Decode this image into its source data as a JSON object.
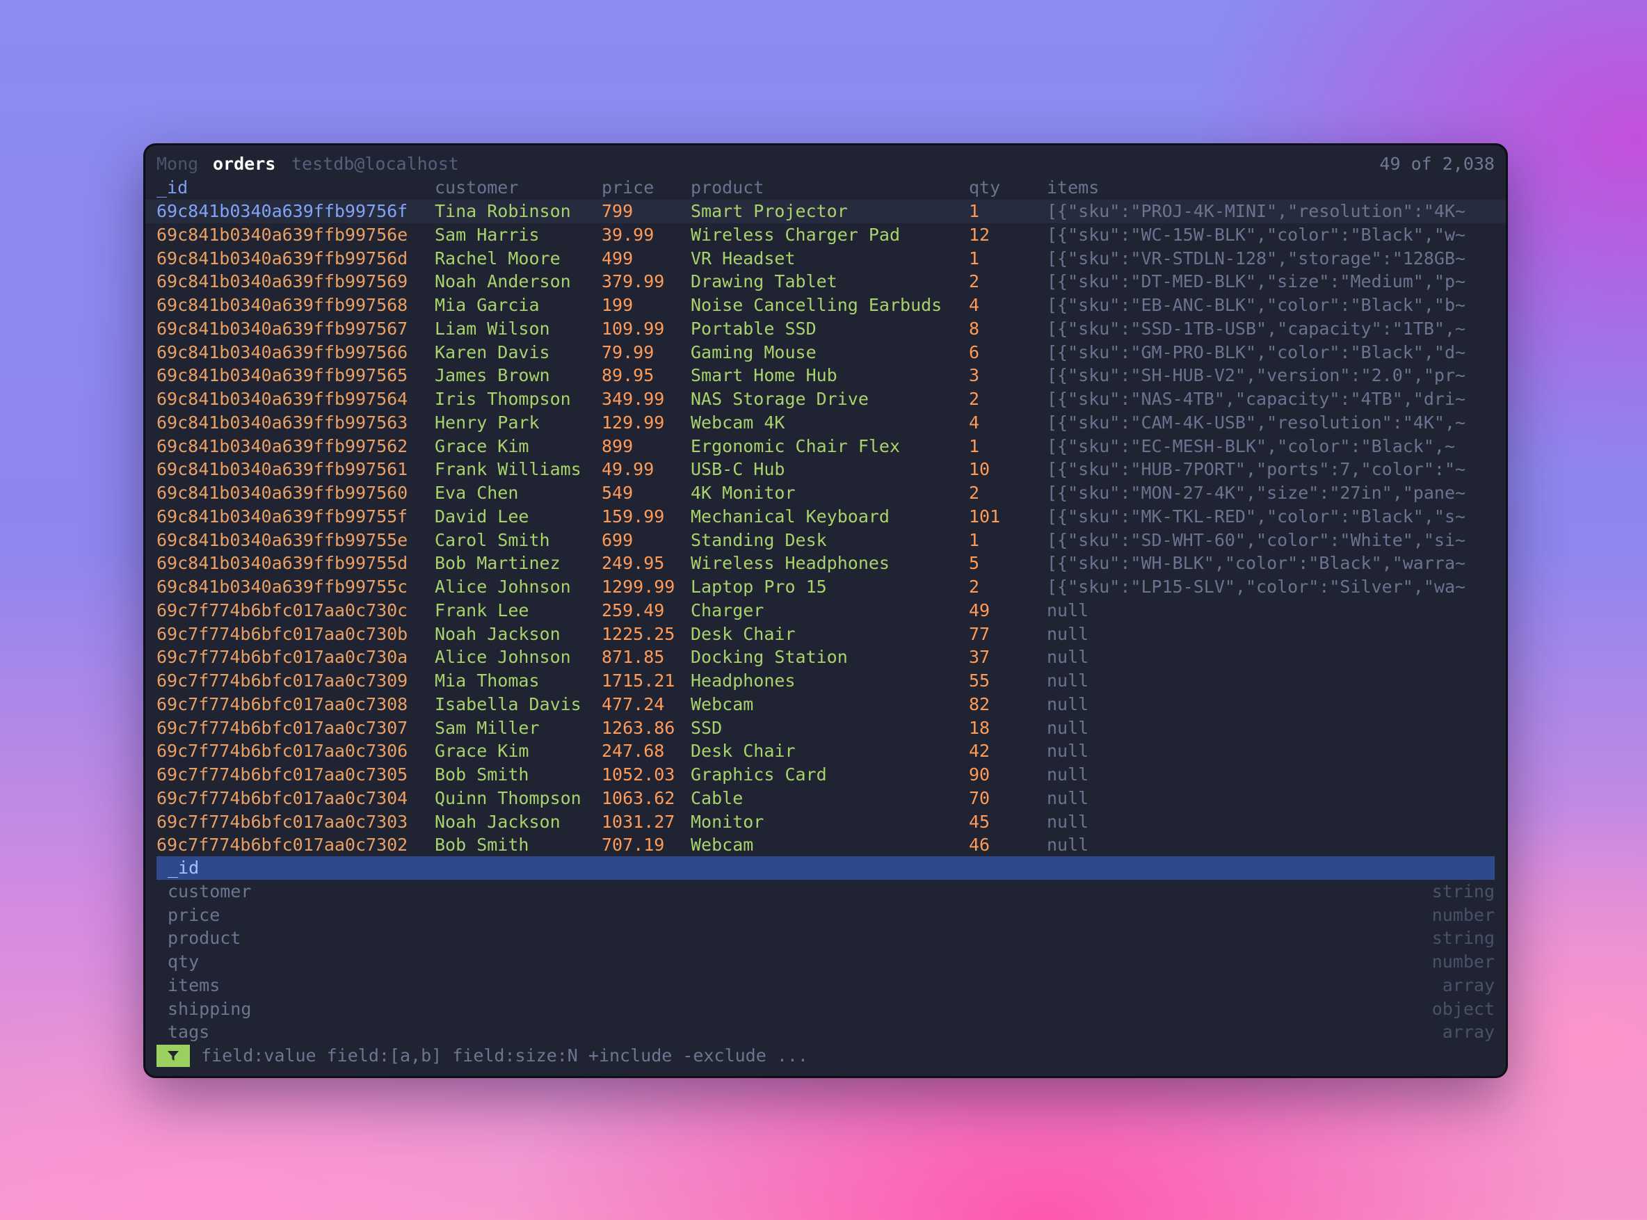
{
  "titlebar": {
    "app": "Mong",
    "collection": "orders",
    "database": "testdb@localhost",
    "count": "49 of 2,038"
  },
  "columns": [
    "_id",
    "customer",
    "price",
    "product",
    "qty",
    "items"
  ],
  "rows": [
    {
      "id": "69c841b0340a639ffb99756f",
      "customer": "Tina Robinson",
      "price": "799",
      "product": "Smart Projector",
      "qty": "1",
      "items": "[{\"sku\":\"PROJ-4K-MINI\",\"resolution\":\"4K~"
    },
    {
      "id": "69c841b0340a639ffb99756e",
      "customer": "Sam Harris",
      "price": "39.99",
      "product": "Wireless Charger Pad",
      "qty": "12",
      "items": "[{\"sku\":\"WC-15W-BLK\",\"color\":\"Black\",\"w~"
    },
    {
      "id": "69c841b0340a639ffb99756d",
      "customer": "Rachel Moore",
      "price": "499",
      "product": "VR Headset",
      "qty": "1",
      "items": "[{\"sku\":\"VR-STDLN-128\",\"storage\":\"128GB~"
    },
    {
      "id": "69c841b0340a639ffb997569",
      "customer": "Noah Anderson",
      "price": "379.99",
      "product": "Drawing Tablet",
      "qty": "2",
      "items": "[{\"sku\":\"DT-MED-BLK\",\"size\":\"Medium\",\"p~"
    },
    {
      "id": "69c841b0340a639ffb997568",
      "customer": "Mia Garcia",
      "price": "199",
      "product": "Noise Cancelling Earbuds",
      "qty": "4",
      "items": "[{\"sku\":\"EB-ANC-BLK\",\"color\":\"Black\",\"b~"
    },
    {
      "id": "69c841b0340a639ffb997567",
      "customer": "Liam Wilson",
      "price": "109.99",
      "product": "Portable SSD",
      "qty": "8",
      "items": "[{\"sku\":\"SSD-1TB-USB\",\"capacity\":\"1TB\",~"
    },
    {
      "id": "69c841b0340a639ffb997566",
      "customer": "Karen Davis",
      "price": "79.99",
      "product": "Gaming Mouse",
      "qty": "6",
      "items": "[{\"sku\":\"GM-PRO-BLK\",\"color\":\"Black\",\"d~"
    },
    {
      "id": "69c841b0340a639ffb997565",
      "customer": "James Brown",
      "price": "89.95",
      "product": "Smart Home Hub",
      "qty": "3",
      "items": "[{\"sku\":\"SH-HUB-V2\",\"version\":\"2.0\",\"pr~"
    },
    {
      "id": "69c841b0340a639ffb997564",
      "customer": "Iris Thompson",
      "price": "349.99",
      "product": "NAS Storage Drive",
      "qty": "2",
      "items": "[{\"sku\":\"NAS-4TB\",\"capacity\":\"4TB\",\"dri~"
    },
    {
      "id": "69c841b0340a639ffb997563",
      "customer": "Henry Park",
      "price": "129.99",
      "product": "Webcam 4K",
      "qty": "4",
      "items": "[{\"sku\":\"CAM-4K-USB\",\"resolution\":\"4K\",~"
    },
    {
      "id": "69c841b0340a639ffb997562",
      "customer": "Grace Kim",
      "price": "899",
      "product": "Ergonomic Chair Flex",
      "qty": "1",
      "items": "[{\"sku\":\"EC-MESH-BLK\",\"color\":\"Black\",~"
    },
    {
      "id": "69c841b0340a639ffb997561",
      "customer": "Frank Williams",
      "price": "49.99",
      "product": "USB-C Hub",
      "qty": "10",
      "items": "[{\"sku\":\"HUB-7PORT\",\"ports\":7,\"color\":\"~"
    },
    {
      "id": "69c841b0340a639ffb997560",
      "customer": "Eva Chen",
      "price": "549",
      "product": "4K Monitor",
      "qty": "2",
      "items": "[{\"sku\":\"MON-27-4K\",\"size\":\"27in\",\"pane~"
    },
    {
      "id": "69c841b0340a639ffb99755f",
      "customer": "David Lee",
      "price": "159.99",
      "product": "Mechanical Keyboard",
      "qty": "101",
      "items": "[{\"sku\":\"MK-TKL-RED\",\"color\":\"Black\",\"s~"
    },
    {
      "id": "69c841b0340a639ffb99755e",
      "customer": "Carol Smith",
      "price": "699",
      "product": "Standing Desk",
      "qty": "1",
      "items": "[{\"sku\":\"SD-WHT-60\",\"color\":\"White\",\"si~"
    },
    {
      "id": "69c841b0340a639ffb99755d",
      "customer": "Bob Martinez",
      "price": "249.95",
      "product": "Wireless Headphones",
      "qty": "5",
      "items": "[{\"sku\":\"WH-BLK\",\"color\":\"Black\",\"warra~"
    },
    {
      "id": "69c841b0340a639ffb99755c",
      "customer": "Alice Johnson",
      "price": "1299.99",
      "product": "Laptop Pro 15",
      "qty": "2",
      "items": "[{\"sku\":\"LP15-SLV\",\"color\":\"Silver\",\"wa~"
    },
    {
      "id": "69c7f774b6bfc017aa0c730c",
      "customer": "Frank Lee",
      "price": "259.49",
      "product": "Charger",
      "qty": "49",
      "items": "null"
    },
    {
      "id": "69c7f774b6bfc017aa0c730b",
      "customer": "Noah Jackson",
      "price": "1225.25",
      "product": "Desk Chair",
      "qty": "77",
      "items": "null"
    },
    {
      "id": "69c7f774b6bfc017aa0c730a",
      "customer": "Alice Johnson",
      "price": "871.85",
      "product": "Docking Station",
      "qty": "37",
      "items": "null"
    },
    {
      "id": "69c7f774b6bfc017aa0c7309",
      "customer": "Mia Thomas",
      "price": "1715.21",
      "product": "Headphones",
      "qty": "55",
      "items": "null"
    },
    {
      "id": "69c7f774b6bfc017aa0c7308",
      "customer": "Isabella Davis",
      "price": "477.24",
      "product": "Webcam",
      "qty": "82",
      "items": "null"
    },
    {
      "id": "69c7f774b6bfc017aa0c7307",
      "customer": "Sam Miller",
      "price": "1263.86",
      "product": "SSD",
      "qty": "18",
      "items": "null"
    },
    {
      "id": "69c7f774b6bfc017aa0c7306",
      "customer": "Grace Kim",
      "price": "247.68",
      "product": "Desk Chair",
      "qty": "42",
      "items": "null"
    },
    {
      "id": "69c7f774b6bfc017aa0c7305",
      "customer": "Bob Smith",
      "price": "1052.03",
      "product": "Graphics Card",
      "qty": "90",
      "items": "null"
    },
    {
      "id": "69c7f774b6bfc017aa0c7304",
      "customer": "Quinn Thompson",
      "price": "1063.62",
      "product": "Cable",
      "qty": "70",
      "items": "null"
    },
    {
      "id": "69c7f774b6bfc017aa0c7303",
      "customer": "Noah Jackson",
      "price": "1031.27",
      "product": "Monitor",
      "qty": "45",
      "items": "null"
    },
    {
      "id": "69c7f774b6bfc017aa0c7302",
      "customer": "Bob Smith",
      "price": "707.19",
      "product": "Webcam",
      "qty": "46",
      "items": "null"
    }
  ],
  "fields": [
    {
      "name": "_id",
      "type": ""
    },
    {
      "name": "customer",
      "type": "string"
    },
    {
      "name": "price",
      "type": "number"
    },
    {
      "name": "product",
      "type": "string"
    },
    {
      "name": "qty",
      "type": "number"
    },
    {
      "name": "items",
      "type": "array"
    },
    {
      "name": "shipping",
      "type": "object"
    },
    {
      "name": "tags",
      "type": "array"
    }
  ],
  "filter": {
    "icon": "filter-funnel-icon",
    "placeholder": "field:value field:[a,b] field:size:N +include -exclude ..."
  },
  "colors": {
    "window_bg": "#1f2332",
    "selected_field_bg": "#2f4a8c",
    "filter_icon_bg": "#9ad060",
    "id_text": "#e9a062",
    "string_text": "#a8d26c",
    "number_text": "#ff9a57"
  }
}
